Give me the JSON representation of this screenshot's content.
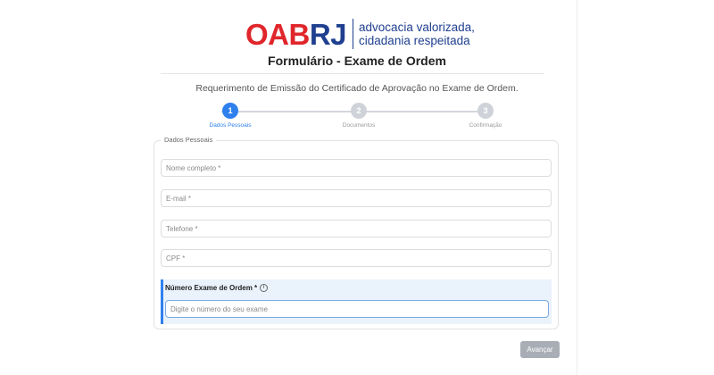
{
  "logo": {
    "part_red": "OAB",
    "part_blue": "RJ",
    "tagline_line1": "advocacia valorizada,",
    "tagline_line2": "cidadania respeitada",
    "colors": {
      "red": "#e0262b",
      "blue": "#1f3f8f"
    }
  },
  "form": {
    "title": "Formulário - Exame de Ordem",
    "subtitle": "Requerimento de Emissão do Certificado de Aprovação no Exame de Ordem."
  },
  "stepper": {
    "steps": [
      {
        "number": "1",
        "label": "Dados Pessoais",
        "state": "active"
      },
      {
        "number": "2",
        "label": "Documentos",
        "state": "pending"
      },
      {
        "number": "3",
        "label": "Confirmação",
        "state": "pending"
      }
    ],
    "accent_color": "#2f80ed"
  },
  "section": {
    "legend": "Dados Pessoais",
    "fields": {
      "name": {
        "placeholder": "Nome completo *",
        "value": ""
      },
      "email": {
        "placeholder": "E-mail *",
        "value": ""
      },
      "phone": {
        "placeholder": "Telefone *",
        "value": ""
      },
      "cpf": {
        "placeholder": "CPF *",
        "value": ""
      }
    },
    "exam_number": {
      "label": "Número Exame de Ordem *",
      "info_icon": "info-circle-icon",
      "placeholder": "Digite o número do seu exame",
      "value": ""
    }
  },
  "actions": {
    "next_label": "Avançar"
  }
}
